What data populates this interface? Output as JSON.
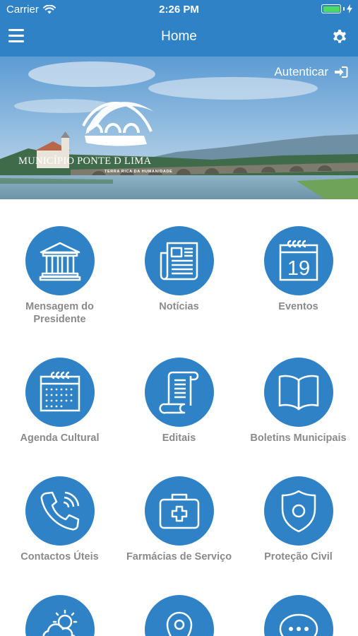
{
  "status_bar": {
    "carrier": "Carrier",
    "time": "2:26 PM",
    "battery_level": 1.0
  },
  "nav": {
    "title": "Home",
    "menu_icon": "hamburger-menu-icon",
    "settings_icon": "gear-icon"
  },
  "hero": {
    "login_label": "Autenticar",
    "login_icon": "sign-in-icon",
    "brand_name": "MUNICÍPIO PONTE D LIMA",
    "brand_tagline": "TERRA RICA DA HUMANIDADE"
  },
  "menu": [
    {
      "label": "Mensagem do Presidente",
      "icon": "institution-icon"
    },
    {
      "label": "Notícias",
      "icon": "newspaper-icon"
    },
    {
      "label": "Eventos",
      "icon": "calendar-19-icon",
      "icon_text": "19"
    },
    {
      "label": "Agenda Cultural",
      "icon": "calendar-grid-icon"
    },
    {
      "label": "Editais",
      "icon": "scroll-icon"
    },
    {
      "label": "Boletins Municipais",
      "icon": "open-book-icon"
    },
    {
      "label": "Contactos Úteis",
      "icon": "phone-icon"
    },
    {
      "label": "Farmácias de Serviço",
      "icon": "first-aid-kit-icon"
    },
    {
      "label": "Proteção Civil",
      "icon": "shield-icon"
    },
    {
      "label": "",
      "icon": "weather-icon"
    },
    {
      "label": "",
      "icon": "map-pin-icon"
    },
    {
      "label": "",
      "icon": "chat-bubble-icon"
    }
  ],
  "colors": {
    "primary": "#2f82c6",
    "label": "#8a8a8a",
    "battery": "#4cd964"
  }
}
